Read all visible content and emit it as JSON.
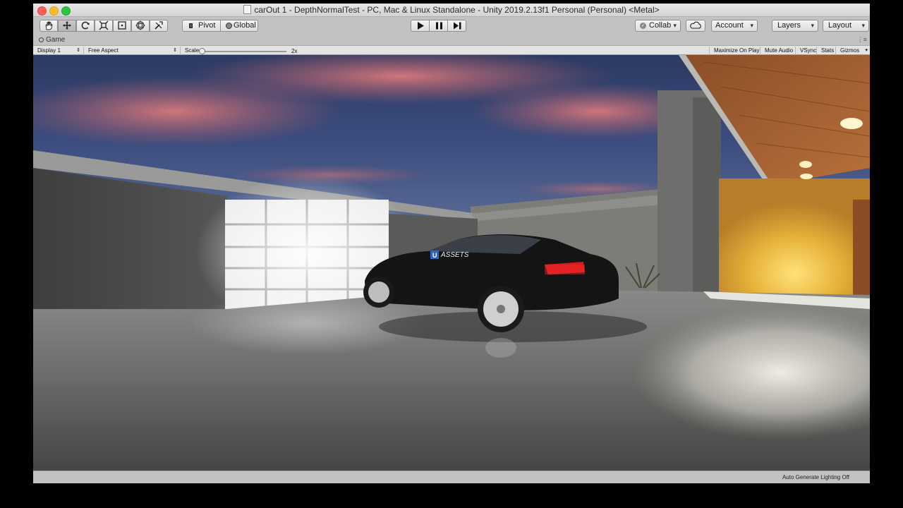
{
  "window": {
    "title": "carOut 1 - DepthNormalTest - PC, Mac & Linux Standalone - Unity 2019.2.13f1 Personal (Personal) <Metal>"
  },
  "toolbar": {
    "pivot_label": "Pivot",
    "global_label": "Global",
    "collab_label": "Collab",
    "account_label": "Account",
    "layers_label": "Layers",
    "layout_label": "Layout",
    "tool_icons": [
      "hand-icon",
      "move-icon",
      "rotate-icon",
      "scale-icon",
      "rect-icon",
      "transform-icon",
      "custom-tool-icon"
    ],
    "active_tool": "move-icon"
  },
  "game_view": {
    "tab_label": "Game",
    "display": "Display 1",
    "aspect": "Free Aspect",
    "scale_label": "Scale",
    "scale_value": "2x",
    "scale_slider_fraction": 0.0,
    "maximize_on_play": "Maximize On Play",
    "mute_audio": "Mute Audio",
    "vsync": "VSync",
    "stats": "Stats",
    "gizmos": "Gizmos",
    "car_badge": "U ASSETS"
  },
  "status": {
    "message": "Auto Generate Lighting Off"
  },
  "colors": {
    "chrome_bg": "#c2c2c2",
    "titlebar": "#d6d6d6",
    "sky_top": "#2c3c66",
    "cloud_pink": "#c46b6f",
    "lamp_glow": "#f2c23a"
  }
}
